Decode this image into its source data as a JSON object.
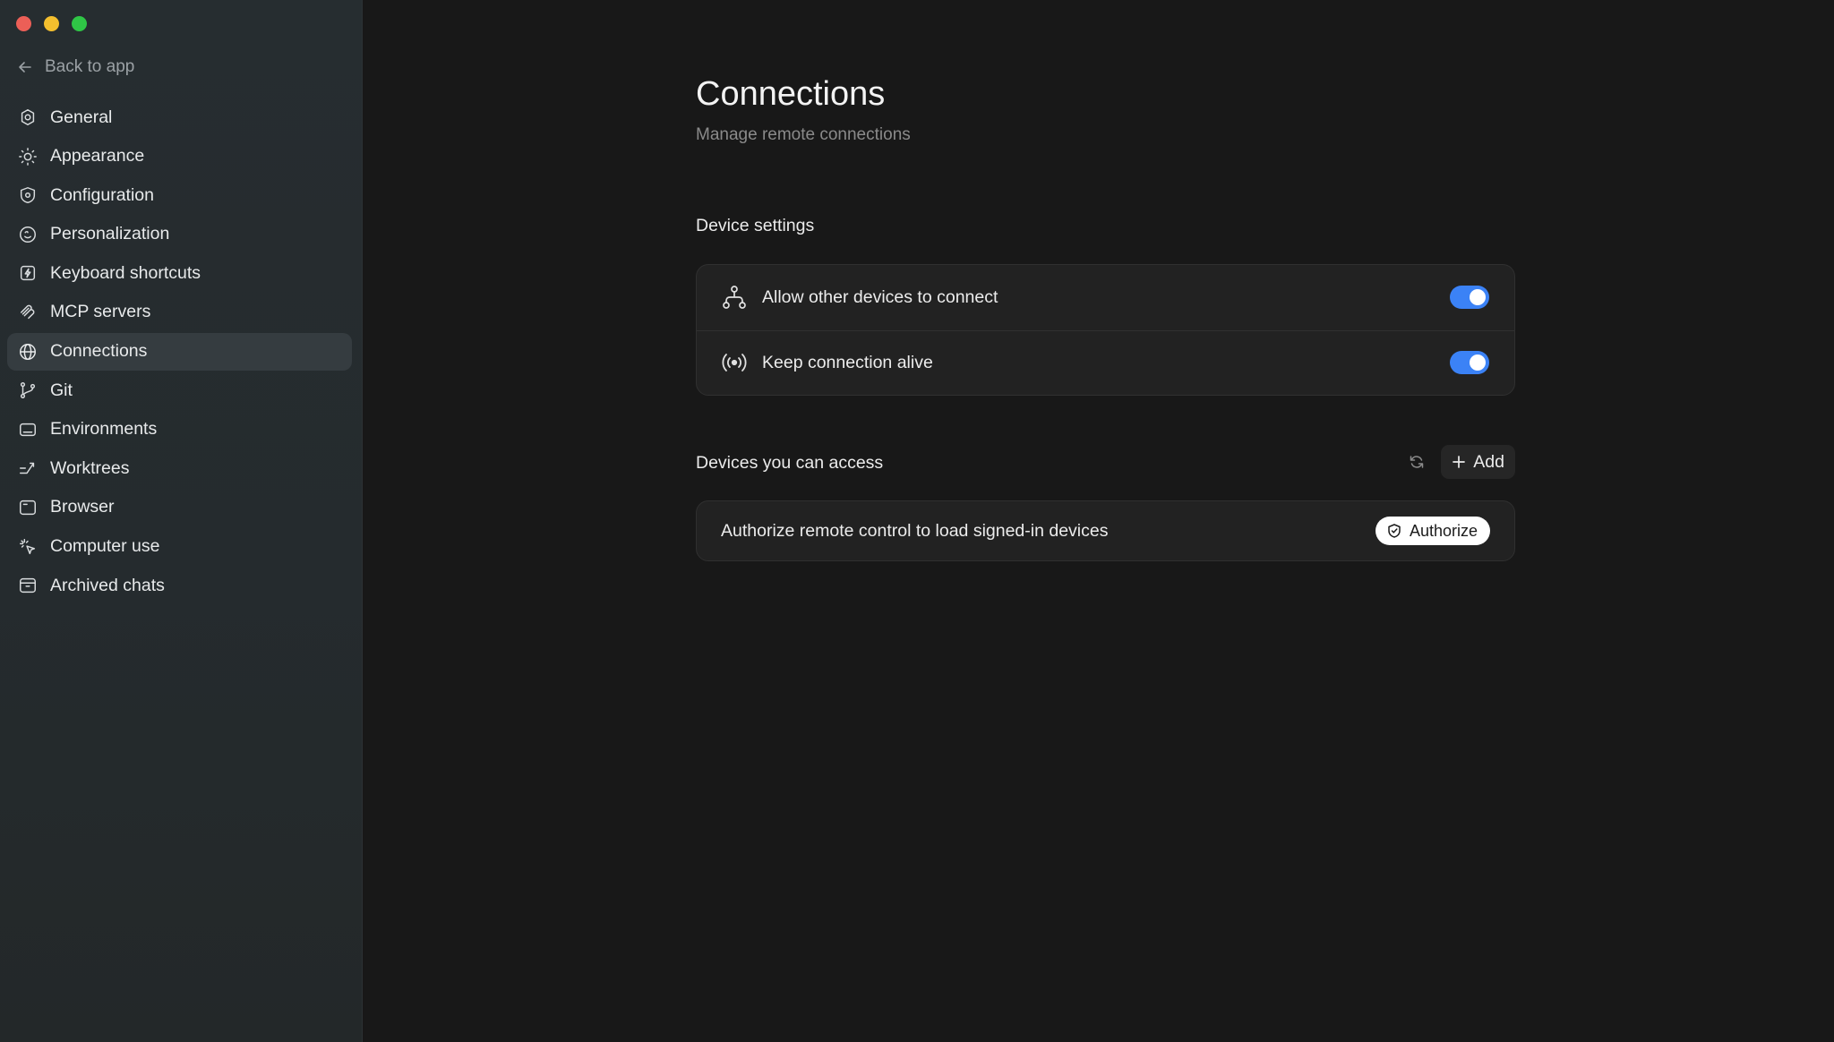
{
  "window": {
    "colors": {
      "close": "#ec5f57",
      "minimize": "#f4bf2e",
      "zoom": "#2fc646"
    }
  },
  "sidebar": {
    "back_label": "Back to app",
    "items": [
      {
        "label": "General",
        "icon": "gear-icon"
      },
      {
        "label": "Appearance",
        "icon": "sun-icon"
      },
      {
        "label": "Configuration",
        "icon": "shield-gear-icon"
      },
      {
        "label": "Personalization",
        "icon": "face-icon"
      },
      {
        "label": "Keyboard shortcuts",
        "icon": "keyboard-bolt-icon"
      },
      {
        "label": "MCP servers",
        "icon": "mcp-icon"
      },
      {
        "label": "Connections",
        "icon": "globe-icon",
        "active": true
      },
      {
        "label": "Git",
        "icon": "git-branch-icon"
      },
      {
        "label": "Environments",
        "icon": "monitor-icon"
      },
      {
        "label": "Worktrees",
        "icon": "worktree-icon"
      },
      {
        "label": "Browser",
        "icon": "browser-icon"
      },
      {
        "label": "Computer use",
        "icon": "cursor-click-icon"
      },
      {
        "label": "Archived chats",
        "icon": "archive-icon"
      }
    ]
  },
  "main": {
    "title": "Connections",
    "subtitle": "Manage remote connections",
    "device_settings": {
      "label": "Device settings",
      "rows": [
        {
          "label": "Allow other devices to connect",
          "icon": "network-icon",
          "enabled": true
        },
        {
          "label": "Keep connection alive",
          "icon": "broadcast-icon",
          "enabled": true
        }
      ]
    },
    "devices": {
      "label": "Devices you can access",
      "add_label": "Add",
      "authorize_text": "Authorize remote control to load signed-in devices",
      "authorize_label": "Authorize"
    },
    "accent_color": "#3b82f6"
  }
}
